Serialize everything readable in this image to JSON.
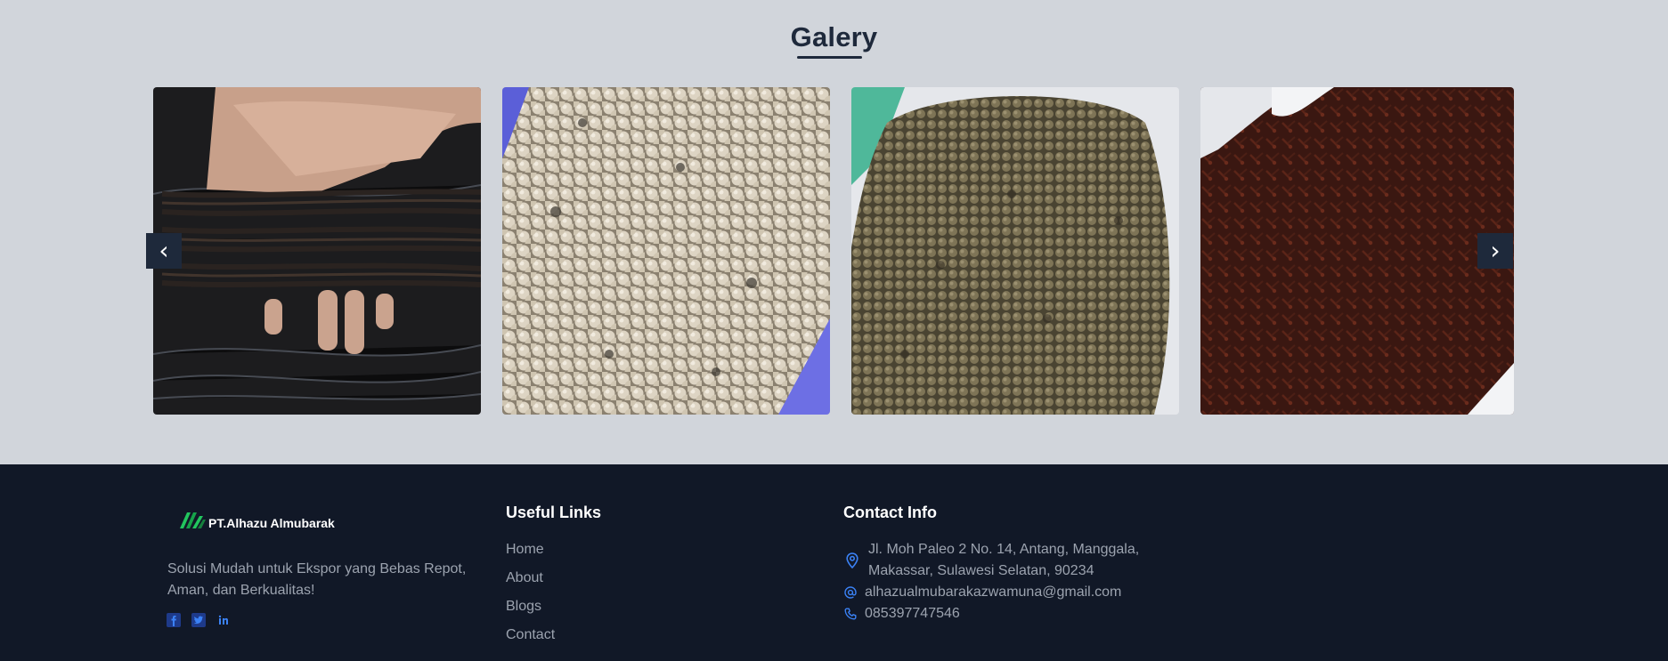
{
  "gallery": {
    "title": "Galery",
    "prev_label": "‹",
    "next_label": "›",
    "images": [
      {
        "subject": "vanilla beans in hand"
      },
      {
        "subject": "white pepper"
      },
      {
        "subject": "dried pepper seeds"
      },
      {
        "subject": "cloves"
      }
    ]
  },
  "footer": {
    "brand": "PT.Alhazu Almubarak",
    "tagline": "Solusi Mudah untuk Ekspor yang Bebas Repot, Aman, dan Berkualitas!",
    "socials": [
      "facebook-icon",
      "twitter-icon",
      "linkedin-icon"
    ],
    "useful_links": {
      "title": "Useful Links",
      "items": [
        "Home",
        "About",
        "Blogs",
        "Contact"
      ]
    },
    "contact": {
      "title": "Contact Info",
      "address": "Jl. Moh Paleo 2 No. 14, Antang, Manggala, Makassar, Sulawesi Selatan, 90234",
      "email": "alhazualmubarakazwamuna@gmail.com",
      "phone": "085397747546"
    }
  },
  "colors": {
    "section_bg": "#d1d5db",
    "footer_bg": "#111827",
    "heading": "#1e293b",
    "accent_icon": "#3b82f6",
    "logo_green": "#22c55e"
  }
}
